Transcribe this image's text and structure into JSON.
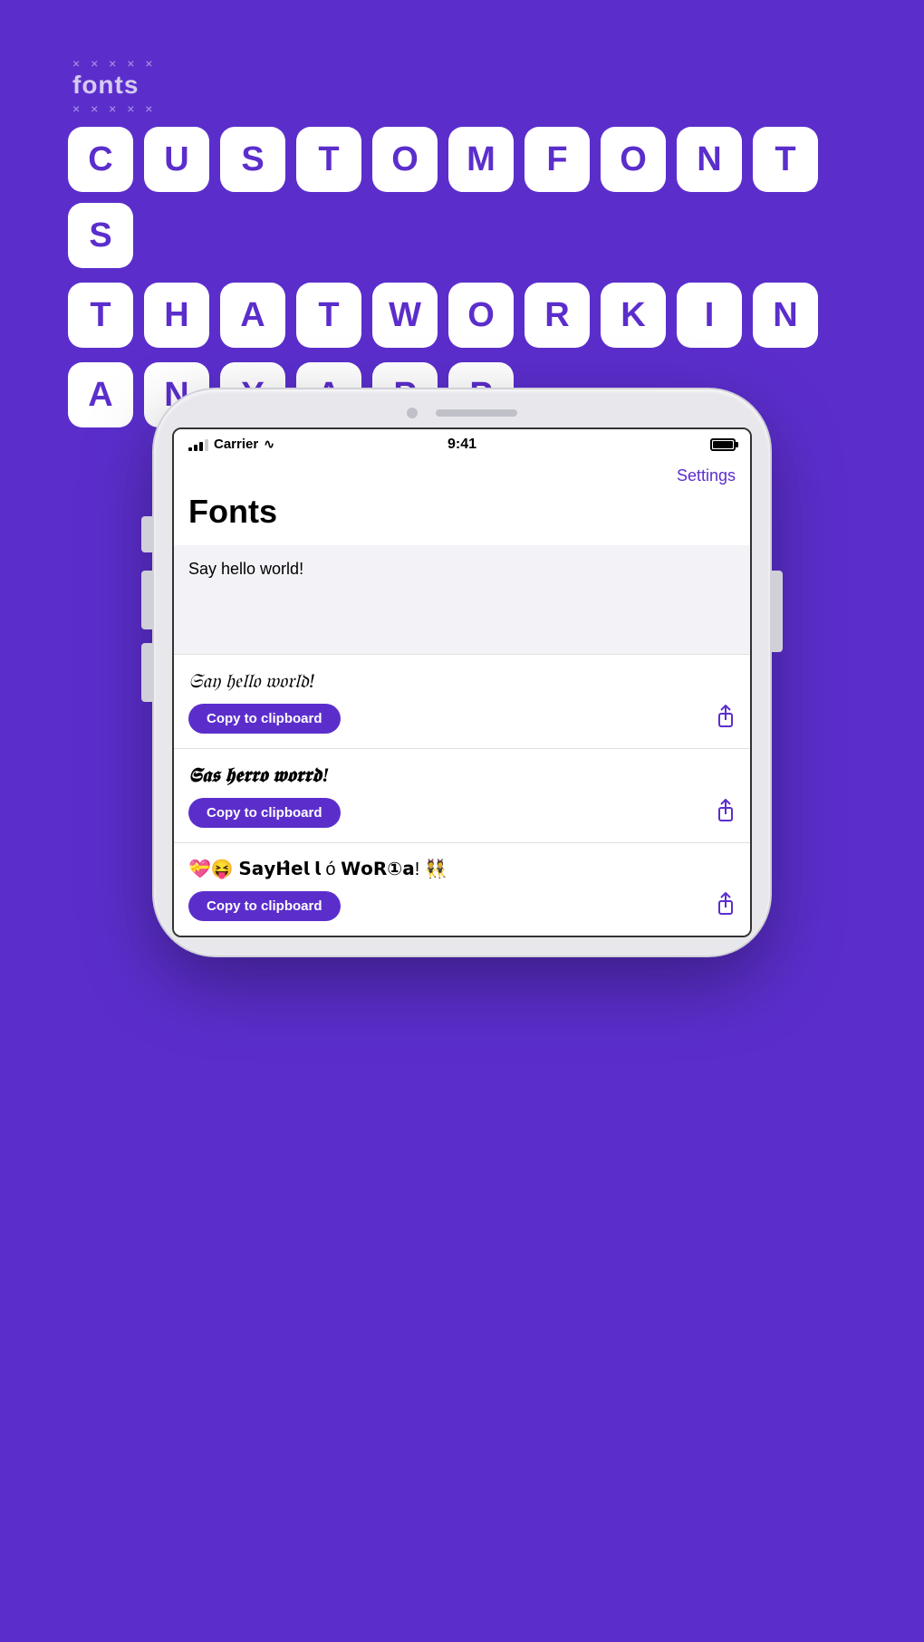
{
  "logo": {
    "text": "fonts",
    "dots_top": "× × × × ×",
    "dots_bottom": "× × × × ×"
  },
  "headline": {
    "row1": [
      "C",
      "U",
      "S",
      "T",
      "O",
      "M",
      "F",
      "O",
      "N",
      "T",
      "S"
    ],
    "row2": [
      "T",
      "H",
      "A",
      "T",
      "W",
      "O",
      "R",
      "K",
      "I",
      "N"
    ],
    "row3": [
      "A",
      "N",
      "Y",
      "A",
      "P",
      "P"
    ]
  },
  "phone": {
    "status": {
      "carrier": "Carrier",
      "time": "9:41",
      "signal_bars": 3
    },
    "settings_label": "Settings",
    "app_title": "Fonts",
    "input_text": "Say hello world!",
    "font_items": [
      {
        "text": "𝔖𝔞𝔶 𝔥𝔢𝔩𝔩𝔬 𝔴𝔬𝔯𝔩𝔡!",
        "copy_label": "Copy to clipboard",
        "style": "gothic-light"
      },
      {
        "text": "𝕾𝖆𝖞 𝖍𝖊𝖑𝖑𝖔 𝖜𝖔𝖗𝖑𝖉!",
        "copy_label": "Copy to clipboard",
        "style": "gothic-bold"
      },
      {
        "text": "💝😝 𝗦𝗮𝘆𝗛̂𝗲𝗹 𝗹 ó 𝗪𝗼𝗥①𝗮! 👯",
        "copy_label": "Copy to clipboard",
        "style": "mixed"
      }
    ]
  },
  "accent_color": "#5B2ECC"
}
